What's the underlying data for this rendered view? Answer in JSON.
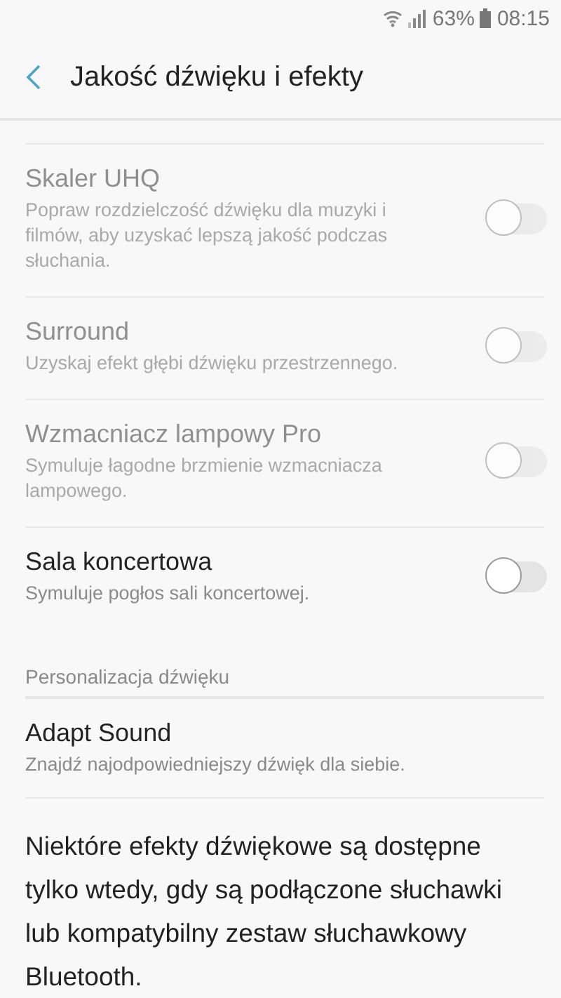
{
  "status_bar": {
    "battery": "63%",
    "time": "08:15"
  },
  "header": {
    "title": "Jakość dźwięku i efekty"
  },
  "items": [
    {
      "kind": "toggle",
      "title": "Skaler UHQ",
      "description": "Popraw rozdzielczość dźwięku dla muzyki i filmów, aby uzyskać lepszą jakość podczas słuchania.",
      "disabled": true,
      "on": false
    },
    {
      "kind": "toggle",
      "title": "Surround",
      "description": "Uzyskaj efekt głębi dźwięku przestrzennego.",
      "disabled": true,
      "on": false
    },
    {
      "kind": "toggle",
      "title": "Wzmacniacz lampowy Pro",
      "description": "Symuluje łagodne brzmienie wzmacniacza lampowego.",
      "disabled": true,
      "on": false
    },
    {
      "kind": "toggle",
      "title": "Sala koncertowa",
      "description": "Symuluje pogłos sali koncertowej.",
      "disabled": false,
      "on": false
    }
  ],
  "section": {
    "title": "Personalizacja dźwięku",
    "items": [
      {
        "kind": "link",
        "title": "Adapt Sound",
        "description": "Znajdź najodpowiedniejszy dźwięk dla siebie."
      }
    ]
  },
  "note": "Niektóre efekty dźwiękowe są dostępne tylko wtedy, gdy są podłączone słuchawki lub kompatybilny zestaw słuchawkowy Bluetooth."
}
